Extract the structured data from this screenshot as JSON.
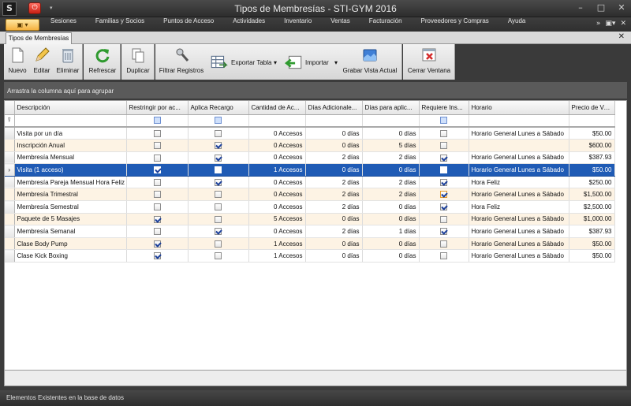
{
  "window": {
    "title": "Tipos de Membresías - STI-GYM 2016",
    "app_icon": "S",
    "min": "–",
    "max": "□",
    "close": "✕"
  },
  "menu": {
    "app_button": "▣ ▾",
    "tabs": [
      "Sesiones",
      "Familias y Socios",
      "Puntos de Acceso",
      "Actividades",
      "Inventario",
      "Ventas",
      "Facturación",
      "Proveedores y Compras",
      "Ayuda"
    ],
    "right_icons": [
      "»",
      "▣▾",
      "✕"
    ]
  },
  "document_tab": {
    "label": "Tipos de Membresías",
    "close": "✕"
  },
  "toolbar": {
    "nuevo": "Nuevo",
    "editar": "Editar",
    "eliminar": "Eliminar",
    "refrescar": "Refrescar",
    "duplicar": "Duplicar",
    "filtrar": "Filtrar Registros",
    "exportar": "Exportar Tabla",
    "importar": "Importar",
    "grabar": "Grabar Vista Actual",
    "cerrar": "Cerrar Ventana"
  },
  "group_panel": "Arrastra la columna aquí para agrupar",
  "grid": {
    "columns": [
      "Descripción",
      "Restringir por ac...",
      "Aplica Recargo",
      "Cantidad de Ac...",
      "Días Adicionale...",
      "Días para aplic...",
      "Requiere Ins...",
      "Horario",
      "Precio de Venta"
    ],
    "rows": [
      {
        "desc": "Visita por un día",
        "restr": false,
        "recargo": false,
        "accesos": "0 Accesos",
        "dias_adic": "0 días",
        "dias_aplic": "0 días",
        "req": false,
        "horario": "Horario General Lunes a Sábado",
        "precio": "$50.00"
      },
      {
        "desc": "Inscripción Anual",
        "restr": false,
        "recargo": true,
        "accesos": "0 Accesos",
        "dias_adic": "0 días",
        "dias_aplic": "5 días",
        "req": false,
        "horario": "",
        "precio": "$600.00"
      },
      {
        "desc": "Membresía Mensual",
        "restr": false,
        "recargo": true,
        "accesos": "0 Accesos",
        "dias_adic": "2 días",
        "dias_aplic": "2 días",
        "req": true,
        "horario": "Horario General Lunes a Sábado",
        "precio": "$387.93"
      },
      {
        "desc": "Visita (1 acceso)",
        "restr": true,
        "recargo": false,
        "accesos": "1 Accesos",
        "dias_adic": "0 días",
        "dias_aplic": "0 días",
        "req": false,
        "horario": "Horario General Lunes a Sábado",
        "precio": "$50.00"
      },
      {
        "desc": "Membresía Pareja Mensual Hora Feliz",
        "restr": false,
        "recargo": true,
        "accesos": "0 Accesos",
        "dias_adic": "2 días",
        "dias_aplic": "2 días",
        "req": true,
        "horario": "Hora Feliz",
        "precio": "$250.00"
      },
      {
        "desc": "Membresía Trimestral",
        "restr": false,
        "recargo": false,
        "accesos": "0 Accesos",
        "dias_adic": "2 días",
        "dias_aplic": "2 días",
        "req": true,
        "horario": "Horario General Lunes a Sábado",
        "precio": "$1,500.00"
      },
      {
        "desc": "Membresía Semestral",
        "restr": false,
        "recargo": false,
        "accesos": "0 Accesos",
        "dias_adic": "2 días",
        "dias_aplic": "0 días",
        "req": true,
        "horario": "Hora Feliz",
        "precio": "$2,500.00"
      },
      {
        "desc": "Paquete de 5 Masajes",
        "restr": true,
        "recargo": false,
        "accesos": "5 Accesos",
        "dias_adic": "0 días",
        "dias_aplic": "0 días",
        "req": false,
        "horario": "Horario General Lunes a Sábado",
        "precio": "$1,000.00"
      },
      {
        "desc": "Membresía Semanal",
        "restr": false,
        "recargo": true,
        "accesos": "0 Accesos",
        "dias_adic": "2 días",
        "dias_aplic": "1 días",
        "req": true,
        "horario": "Horario General Lunes a Sábado",
        "precio": "$387.93"
      },
      {
        "desc": "Clase Body Pump",
        "restr": true,
        "recargo": false,
        "accesos": "1 Accesos",
        "dias_adic": "0 días",
        "dias_aplic": "0 días",
        "req": false,
        "horario": "Horario General Lunes a Sábado",
        "precio": "$50.00"
      },
      {
        "desc": "Clase Kick Boxing",
        "restr": true,
        "recargo": false,
        "accesos": "1 Accesos",
        "dias_adic": "0 días",
        "dias_aplic": "0 días",
        "req": false,
        "horario": "Horario General Lunes a Sábado",
        "precio": "$50.00"
      }
    ],
    "selected_row": 3,
    "current_row_marker": "›",
    "filter_icon": "⍒"
  },
  "status": "Elementos Existentes en la base de datos",
  "colors": {
    "accent": "#1f5bb5",
    "alt_row": "#fdf3e4",
    "chrome": "#3b3b3b"
  }
}
